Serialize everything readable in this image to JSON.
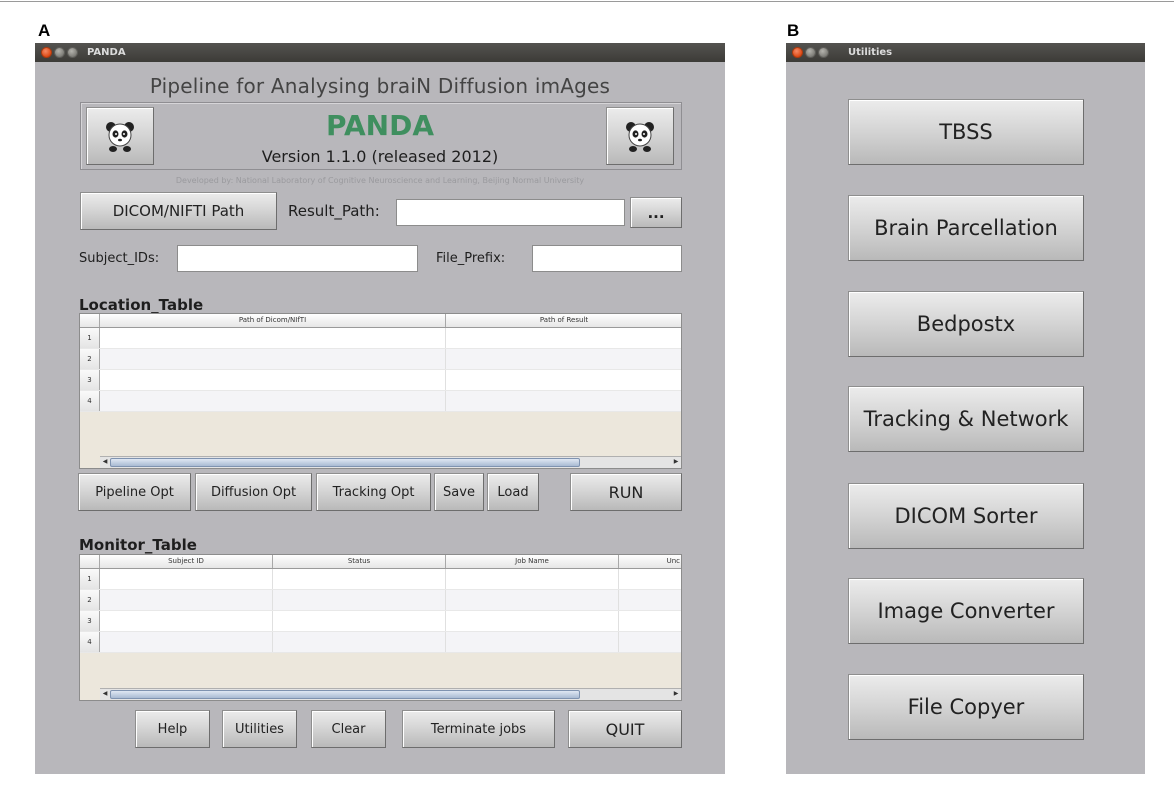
{
  "panels": {
    "a": "A",
    "b": "B"
  },
  "panda_window": {
    "title": "PANDA",
    "app_title": "Pipeline for Analysing braiN Diffusion imAges",
    "app_name": "PANDA",
    "version": "Version 1.1.0 (released 2012)",
    "credit": "Developed by: National Laboratory of Cognitive Neuroscience and Learning, Beijing Normal University",
    "logo_icon": "panda-icon",
    "dicom_button": "DICOM/NIFTI Path",
    "result_path_label": "Result_Path:",
    "result_path_value": "",
    "browse_button": "...",
    "subject_ids_label": "Subject_IDs:",
    "subject_ids_value": "",
    "file_prefix_label": "File_Prefix:",
    "file_prefix_value": "",
    "location_table": {
      "title": "Location_Table",
      "columns": [
        "Path of Dicom/NIfTI",
        "Path of Result"
      ],
      "rows": [
        "1",
        "2",
        "3",
        "4"
      ]
    },
    "actions": {
      "pipeline_opt": "Pipeline Opt",
      "diffusion_opt": "Diffusion Opt",
      "tracking_opt": "Tracking Opt",
      "save": "Save",
      "load": "Load",
      "run": "RUN"
    },
    "monitor_table": {
      "title": "Monitor_Table",
      "columns": [
        "Subject ID",
        "Status",
        "Job Name",
        "Unc"
      ],
      "rows": [
        "1",
        "2",
        "3",
        "4"
      ]
    },
    "footer": {
      "help": "Help",
      "utilities": "Utilities",
      "clear": "Clear",
      "terminate": "Terminate jobs",
      "quit": "QUIT"
    }
  },
  "utilities_window": {
    "title": "Utilities",
    "buttons": [
      "TBSS",
      "Brain Parcellation",
      "Bedpostx",
      "Tracking & Network",
      "DICOM Sorter",
      "Image Converter",
      "File Copyer"
    ]
  },
  "colors": {
    "window_bg": "#b8b7bb",
    "titlebar": "#3c3b37",
    "panda_green": "#3f8f5f",
    "close_button": "#dd4814"
  }
}
